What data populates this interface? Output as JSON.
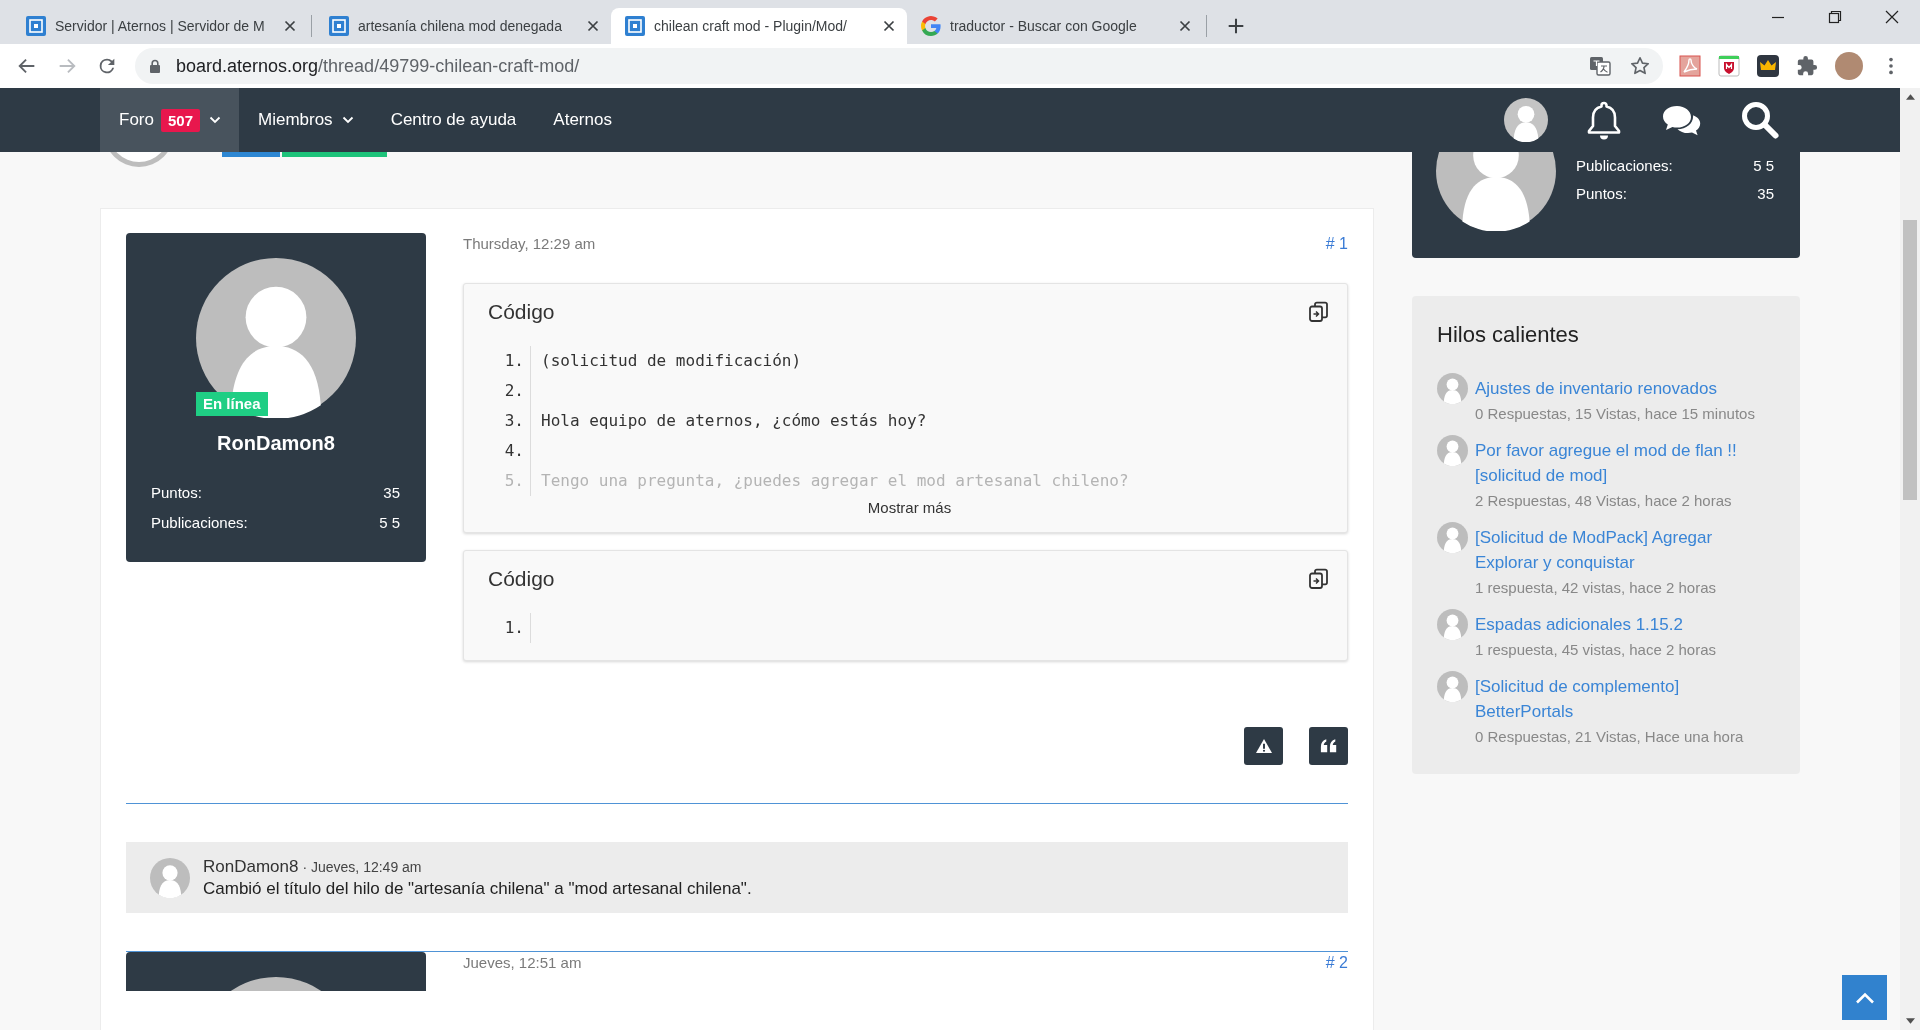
{
  "browser": {
    "tabs": [
      {
        "kind": "aternos",
        "title": "Servidor | Aternos | Servidor de M",
        "selected": false
      },
      {
        "kind": "aternos",
        "title": "artesanía chilena mod denegada",
        "selected": false
      },
      {
        "kind": "aternos",
        "title": "chilean craft mod - Plugin/Mod/",
        "selected": true
      },
      {
        "kind": "google",
        "title": "traductor - Buscar con Google",
        "selected": false
      }
    ],
    "address": {
      "host": "board.aternos.org",
      "path": "/thread/49799-chilean-craft-mod/"
    }
  },
  "nav": {
    "items": [
      {
        "label": "Foro",
        "badge": "507",
        "dropdown": true,
        "selected": true
      },
      {
        "label": "Miembros",
        "dropdown": true,
        "selected": false
      },
      {
        "label": "Centro de ayuda",
        "dropdown": false,
        "selected": false
      },
      {
        "label": "Aternos",
        "dropdown": false,
        "selected": false
      }
    ]
  },
  "thread": {
    "items": [
      {
        "kind": "post",
        "author": {
          "name": "RonDamon8",
          "status": "En línea",
          "stats": [
            {
              "label": "Puntos:",
              "value": "35"
            },
            {
              "label": "Publicaciones:",
              "value": "5 5"
            }
          ]
        },
        "date": "Thursday, 12:29 am",
        "number": "# 1",
        "code_blocks": [
          {
            "title": "Código",
            "lines": [
              {
                "number": "1.",
                "text": "(solicitud de modificación)",
                "faded": false
              },
              {
                "number": "2.",
                "faded": false
              },
              {
                "number": "3.",
                "text": "Hola equipo de aternos, ¿cómo estás hoy?",
                "faded": false
              },
              {
                "number": "4.",
                "faded": false
              },
              {
                "number": "5.",
                "text": "Tengo una pregunta, ¿puedes agregar el mod artesanal chileno?",
                "faded": true
              }
            ],
            "more": "Mostrar más"
          },
          {
            "title": "Código",
            "lines": [
              {
                "number": "1.",
                "faded": false
              }
            ]
          }
        ]
      },
      {
        "kind": "notice",
        "user": "RonDamon8",
        "time": "· Jueves, 12:49 am",
        "message": "Cambió el título del hilo de \"artesanía chilena\" a \"mod artesanal chilena\"."
      },
      {
        "kind": "post",
        "date": "Jueves, 12:51 am",
        "number": "# 2"
      }
    ]
  },
  "sidebar": {
    "profile": {
      "stats": [
        {
          "label": "Publicaciones:",
          "value": "5 5"
        },
        {
          "label": "Puntos:",
          "value": "35"
        }
      ]
    },
    "hot_threads": {
      "title": "Hilos calientes",
      "items": [
        {
          "title": "Ajustes de inventario renovados",
          "meta": "0 Respuestas, 15 Vistas, hace 15 minutos"
        },
        {
          "title": "Por favor agregue el mod de flan !! [solicitud de mod]",
          "meta": "2 Respuestas, 48 Vistas, hace 2 horas"
        },
        {
          "title": "[Solicitud de ModPack] Agregar Explorar y conquistar",
          "meta": "1 respuesta, 42 vistas, hace 2 horas"
        },
        {
          "title": "Espadas adicionales 1.15.2",
          "meta": "1 respuesta, 45 vistas, hace 2 horas"
        },
        {
          "title": "[Solicitud de complemento] BetterPortals",
          "meta": "0 Respuestas, 21 Vistas, Hace una hora"
        }
      ]
    }
  }
}
